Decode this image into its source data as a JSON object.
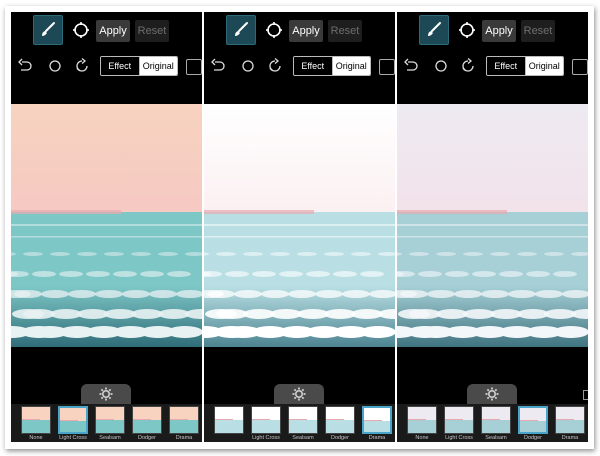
{
  "panels": [
    {
      "toolbar": {
        "apply_label": "Apply",
        "reset_label": "Reset"
      },
      "view_toggle": {
        "effect_label": "Effect",
        "original_label": "Original",
        "selected": "Original"
      },
      "photo_tint": {
        "sky_top": "#f7d3c0",
        "sky_bottom": "#f6c9c2",
        "sea": "#7ec7c7",
        "sea_dark": "#2f6d78",
        "foam": "#e9f2f3"
      },
      "filters": [
        {
          "label": "None",
          "selected": false
        },
        {
          "label": "Light Cross",
          "selected": true
        },
        {
          "label": "Sealsam",
          "selected": false
        },
        {
          "label": "Dodger",
          "selected": false
        },
        {
          "label": "Drama",
          "selected": false
        }
      ]
    },
    {
      "toolbar": {
        "apply_label": "Apply",
        "reset_label": "Reset"
      },
      "view_toggle": {
        "effect_label": "Effect",
        "original_label": "Original",
        "selected": "Original"
      },
      "photo_tint": {
        "sky_top": "#ffffff",
        "sky_bottom": "#fbf0f2",
        "sea": "#b9dfe4",
        "sea_dark": "#4d8491",
        "foam": "#ffffff"
      },
      "filters": [
        {
          "label": "",
          "selected": false
        },
        {
          "label": "Light Cross",
          "selected": false
        },
        {
          "label": "Sealsam",
          "selected": false
        },
        {
          "label": "Dodger",
          "selected": false
        },
        {
          "label": "Drama",
          "selected": true
        }
      ]
    },
    {
      "toolbar": {
        "apply_label": "Apply",
        "reset_label": "Reset"
      },
      "view_toggle": {
        "effect_label": "Effect",
        "original_label": "Original",
        "selected": "Original"
      },
      "photo_tint": {
        "sky_top": "#eeeaf2",
        "sky_bottom": "#f2e2ea",
        "sea": "#a6cfd6",
        "sea_dark": "#3f7480",
        "foam": "#f4f7fa"
      },
      "filters": [
        {
          "label": "None",
          "selected": false
        },
        {
          "label": "Light Cross",
          "selected": false
        },
        {
          "label": "Sealsam",
          "selected": false
        },
        {
          "label": "Dodger",
          "selected": true
        },
        {
          "label": "Drama",
          "selected": false
        }
      ]
    }
  ],
  "icons": {
    "brush": "paintbrush-icon",
    "crop": "crop-circle-icon",
    "undo": "undo-icon",
    "circle": "circle-icon",
    "rotate": "rotate-icon",
    "gear": "gear-icon"
  },
  "colors": {
    "accent": "#4aa3c8",
    "brush_bg": "#1d4956",
    "panel_bg": "#000000"
  }
}
